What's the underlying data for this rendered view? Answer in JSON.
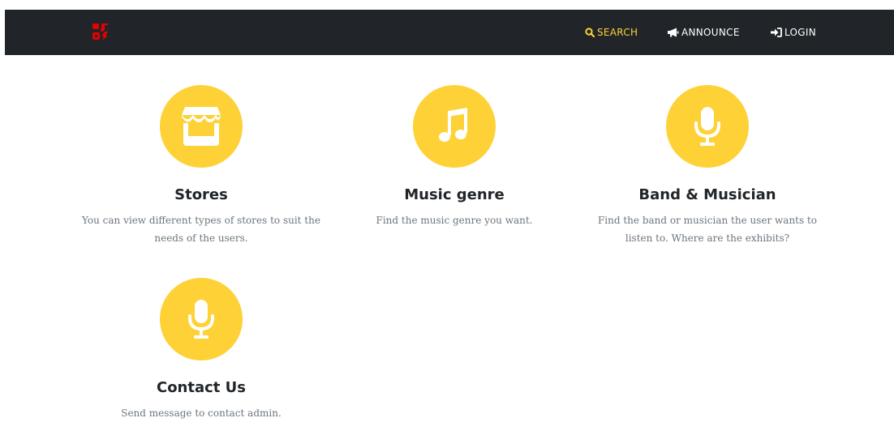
{
  "brand": {
    "logo_icon": "brand-logo-icon",
    "logo_color": "#e60000"
  },
  "nav": {
    "search": {
      "label": "SEARCH",
      "icon": "search-icon",
      "active": true
    },
    "announce": {
      "label": "ANNOUNCE",
      "icon": "megaphone-icon"
    },
    "login": {
      "label": "LOGIN",
      "icon": "sign-in-icon"
    }
  },
  "colors": {
    "navbar_bg": "#212529",
    "accent": "#fed136",
    "heading": "#212529",
    "body_text": "#6c757d"
  },
  "features": [
    {
      "icon": "store-icon",
      "title": "Stores",
      "description": "You can view different types of stores to suit the needs of the users."
    },
    {
      "icon": "music-note-icon",
      "title": "Music genre",
      "description": "Find the music genre you want."
    },
    {
      "icon": "microphone-icon",
      "title": "Band & Musician",
      "description": "Find the band or musician the user wants to listen to. Where are the exhibits?"
    },
    {
      "icon": "microphone-icon",
      "title": "Contact Us",
      "description": "Send message to contact admin."
    }
  ]
}
